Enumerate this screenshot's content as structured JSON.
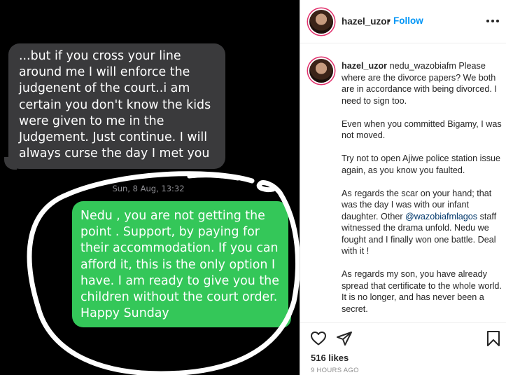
{
  "post": {
    "messages": {
      "received": "...but if you cross your line around me I will enforce the judgenent of the court..i am certain you don't know the kids were given to me in the Judgement. Just continue. I will always curse the day I met you",
      "timestamp": "Sun, 8 Aug, 13:32",
      "sent": "Nedu , you are not getting the point . Support, by paying for their accommodation. If you can afford it, this is the only option I have. I am ready to give you the children without the court order. Happy Sunday"
    }
  },
  "header": {
    "username": "hazel_uzor",
    "separator": "•",
    "follow_label": "Follow",
    "more_icon": "more-horizontal-icon"
  },
  "caption": {
    "username": "hazel_uzor",
    "mention_user": "nedu_wazobiafm",
    "paragraphs": [
      "Please where are the divorce papers? We both are in accordance with being divorced. I need to sign too.",
      "Even when you committed Bigamy, I was not moved.",
      "Try not to open Ajiwe police station issue again, as you know you faulted."
    ],
    "scar_before": "As regards the scar on your hand; that was the day I was with our infant daughter. Other ",
    "scar_mention": "@wazobiafmlagos",
    "scar_after": " staff witnessed the drama unfold. Nedu we fought and I finally won one battle. Deal with it !",
    "last_paragraph": "As regards my son, you have already spread that certificate to the whole world. It is no longer, and has never been a secret."
  },
  "actions": {
    "icons": [
      "heart-icon",
      "share-icon",
      "bookmark-icon"
    ],
    "likes": "516 likes",
    "time": "9 HOURS AGO"
  },
  "colors": {
    "received_bubble": "#3a3a3c",
    "sent_bubble": "#34c759",
    "follow": "#0095f6",
    "mention": "#00376b"
  }
}
